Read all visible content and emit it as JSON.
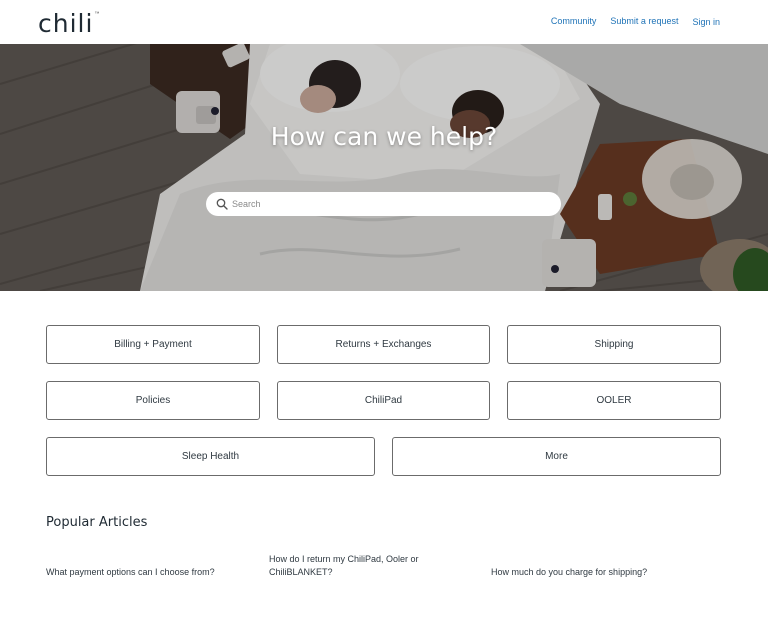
{
  "header": {
    "logo_text": "chili",
    "logo_tm": "™",
    "nav": [
      {
        "label": "Community"
      },
      {
        "label": "Submit a request"
      },
      {
        "label": "Sign in"
      }
    ]
  },
  "hero": {
    "title": "How can we help?",
    "search_placeholder": "Search"
  },
  "categories": [
    {
      "label": "Billing + Payment"
    },
    {
      "label": "Returns + Exchanges"
    },
    {
      "label": "Shipping"
    },
    {
      "label": "Policies"
    },
    {
      "label": "ChiliPad"
    },
    {
      "label": "OOLER"
    },
    {
      "label": "Sleep Health"
    },
    {
      "label": "More"
    }
  ],
  "popular": {
    "title": "Popular Articles",
    "articles": [
      {
        "title": "What payment options can I choose from?"
      },
      {
        "title": "How do I return my ChiliPad, Ooler or ChiliBLANKET?"
      },
      {
        "title": "How much do you charge for shipping?"
      }
    ]
  },
  "colors": {
    "link": "#1f73b7",
    "border": "#6b6b6b",
    "text": "#2f3941"
  }
}
